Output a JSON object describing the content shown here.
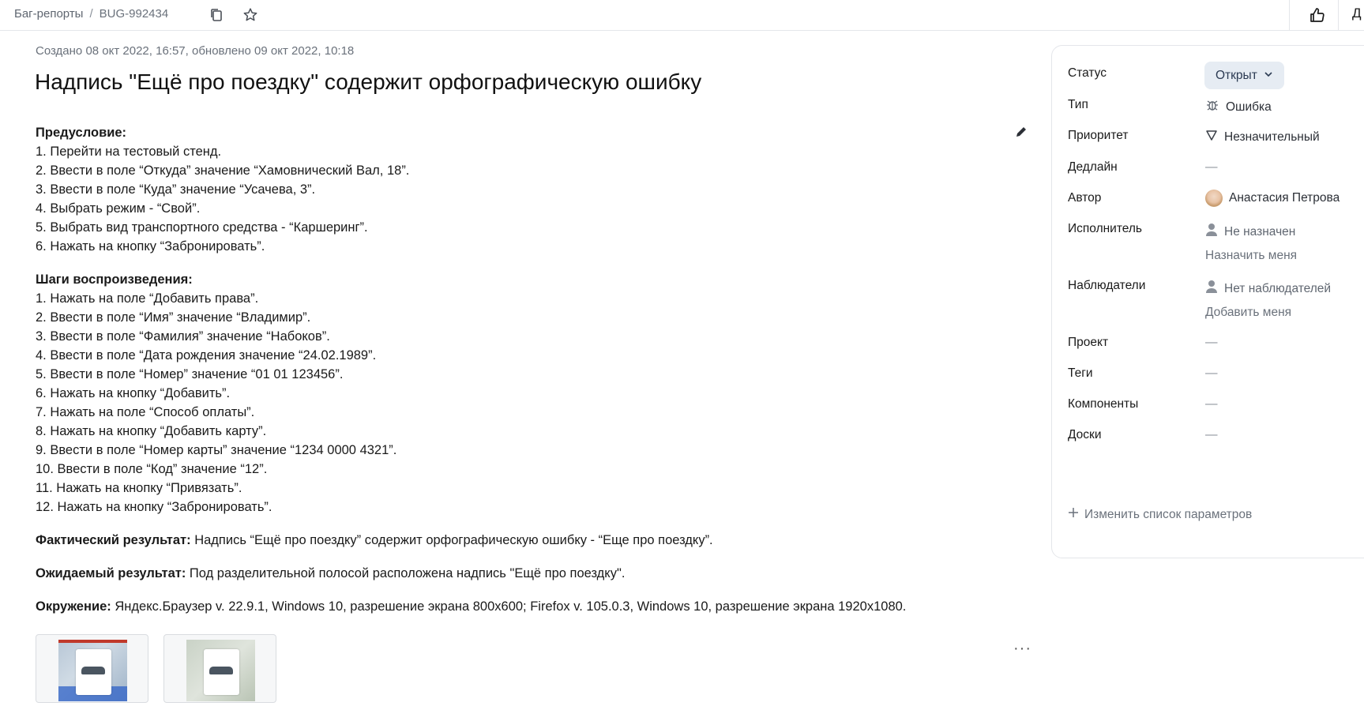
{
  "breadcrumb": {
    "section": "Баг-репорты",
    "separator": "/",
    "issue_id": "BUG-992434"
  },
  "topbar": {
    "cut_text": "Д",
    "icons": [
      "copy-icon",
      "star-icon",
      "thumbs-up-icon"
    ]
  },
  "issue": {
    "meta": "Создано 08 окт 2022, 16:57, обновлено 09 окт 2022, 10:18",
    "title": "Надпись \"Ещё про поездку\" содержит орфографическую ошибку"
  },
  "description": {
    "precondition_heading": "Предусловие:",
    "precondition_steps": [
      "1. Перейти на тестовый стенд.",
      "2. Ввести в поле “Откуда” значение “Хамовнический Вал, 18”.",
      "3. Ввести в поле “Куда” значение “Усачева, 3”.",
      "4. Выбрать режим - “Свой”.",
      "5. Выбрать вид транспортного средства - “Каршеринг”.",
      "6. Нажать на кнопку “Забронировать”."
    ],
    "steps_heading": "Шаги воспроизведения:",
    "steps": [
      "1. Нажать на поле “Добавить права”.",
      "2. Ввести в поле “Имя” значение “Владимир”.",
      "3. Ввести в поле “Фамилия” значение “Набоков”.",
      "4. Ввести в поле “Дата рождения значение “24.02.1989”.",
      "5. Ввести в поле “Номер” значение “01 01 123456”.",
      "6. Нажать на кнопку “Добавить”.",
      "7. Нажать на поле “Способ оплаты”.",
      "8. Нажать на кнопку “Добавить карту”.",
      "9. Ввести в поле “Номер карты” значение “1234 0000 4321”.",
      "10. Ввести в поле “Код” значение “12”.",
      "11. Нажать на кнопку “Привязать”.",
      "12. Нажать на кнопку “Забронировать”."
    ],
    "actual_label": "Фактический результат:",
    "actual_text": "Надпись “Ещё про поездку” содержит орфографическую ошибку - “Еще про поездку”.",
    "expected_label": "Ожидаемый результат:",
    "expected_text": "Под разделительной полосой расположена надпись \"Ещё про поездку\".",
    "env_label": "Окружение:",
    "env_text": "Яндекс.Браузер v. 22.9.1, Windows 10, разрешение экрана 800x600; Firefox v. 105.0.3, Windows 10, разрешение экрана 1920x1080."
  },
  "attachments": {
    "count": 2,
    "more_label": "···"
  },
  "sidebar": {
    "status_label": "Статус",
    "status_value": "Открыт",
    "type_label": "Тип",
    "type_value": "Ошибка",
    "priority_label": "Приоритет",
    "priority_value": "Незначительный",
    "deadline_label": "Дедлайн",
    "deadline_value": "—",
    "author_label": "Автор",
    "author_value": "Анастасия Петрова",
    "assignee_label": "Исполнитель",
    "assignee_value": "Не назначен",
    "assign_me": "Назначить меня",
    "watchers_label": "Наблюдатели",
    "watchers_value": "Нет наблюдателей",
    "add_me": "Добавить меня",
    "project_label": "Проект",
    "project_value": "—",
    "tags_label": "Теги",
    "tags_value": "—",
    "components_label": "Компоненты",
    "components_value": "—",
    "boards_label": "Доски",
    "boards_value": "—",
    "change_params": "Изменить список параметров"
  }
}
